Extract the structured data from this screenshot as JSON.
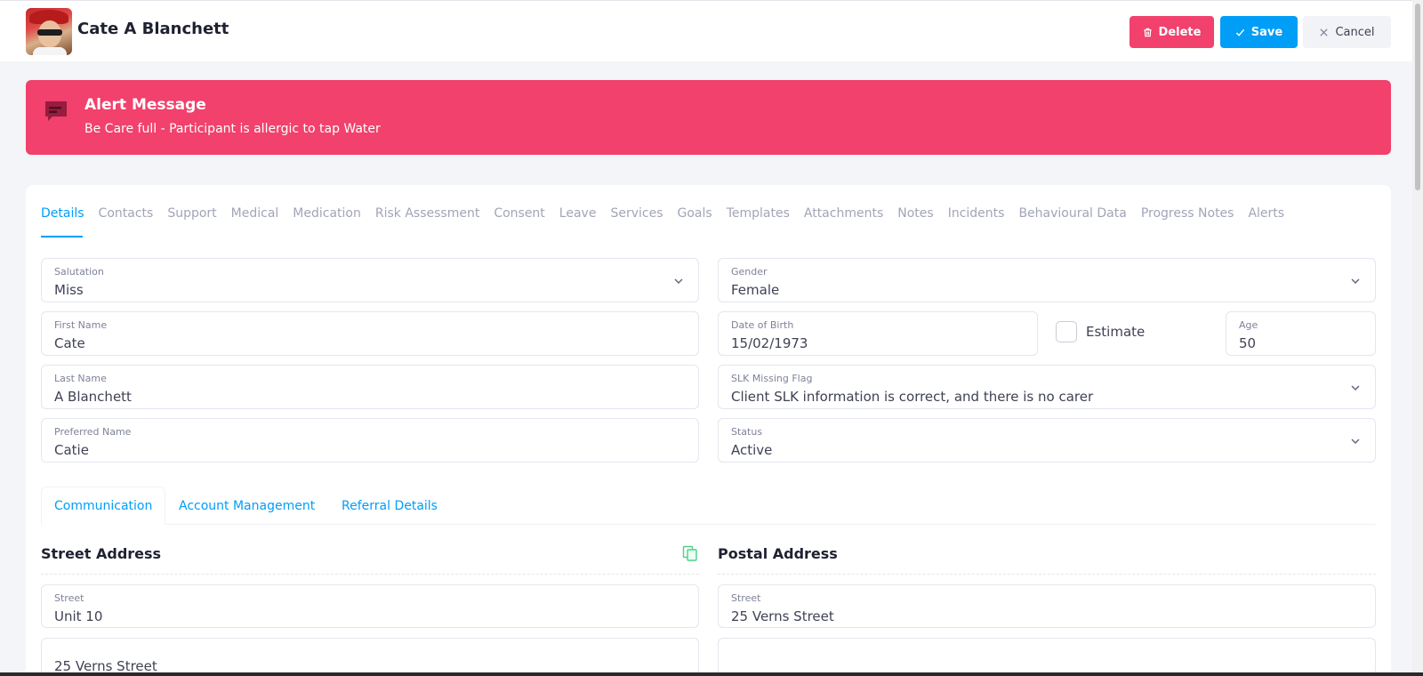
{
  "header": {
    "name": "Cate A Blanchett",
    "buttons": {
      "delete": "Delete",
      "save": "Save",
      "cancel": "Cancel"
    }
  },
  "alert": {
    "title": "Alert Message",
    "message": "Be Care full - Participant is allergic to tap Water"
  },
  "tabs": [
    "Details",
    "Contacts",
    "Support",
    "Medical",
    "Medication",
    "Risk Assessment",
    "Consent",
    "Leave",
    "Services",
    "Goals",
    "Templates",
    "Attachments",
    "Notes",
    "Incidents",
    "Behavioural Data",
    "Progress Notes",
    "Alerts"
  ],
  "form": {
    "salutation": {
      "label": "Salutation",
      "value": "Miss"
    },
    "first_name": {
      "label": "First Name",
      "value": "Cate"
    },
    "last_name": {
      "label": "Last Name",
      "value": "A Blanchett"
    },
    "preferred_name": {
      "label": "Preferred Name",
      "value": "Catie"
    },
    "gender": {
      "label": "Gender",
      "value": "Female"
    },
    "dob": {
      "label": "Date of Birth",
      "value": "15/02/1973"
    },
    "estimate": {
      "label": "Estimate",
      "checked": false
    },
    "age": {
      "label": "Age",
      "value": "50"
    },
    "slk": {
      "label": "SLK Missing Flag",
      "value": "Client SLK information is correct, and there is no carer"
    },
    "status": {
      "label": "Status",
      "value": "Active"
    }
  },
  "subtabs": [
    "Communication",
    "Account Management",
    "Referral Details"
  ],
  "street_address": {
    "title": "Street Address",
    "street_label": "Street",
    "street_value": "Unit 10",
    "street2_value": "25 Verns Street"
  },
  "postal_address": {
    "title": "Postal Address",
    "street_label": "Street",
    "street_value": "25 Verns Street"
  },
  "colors": {
    "primary": "#009ef7",
    "danger": "#f1416c",
    "background": "#f3f5f8"
  }
}
